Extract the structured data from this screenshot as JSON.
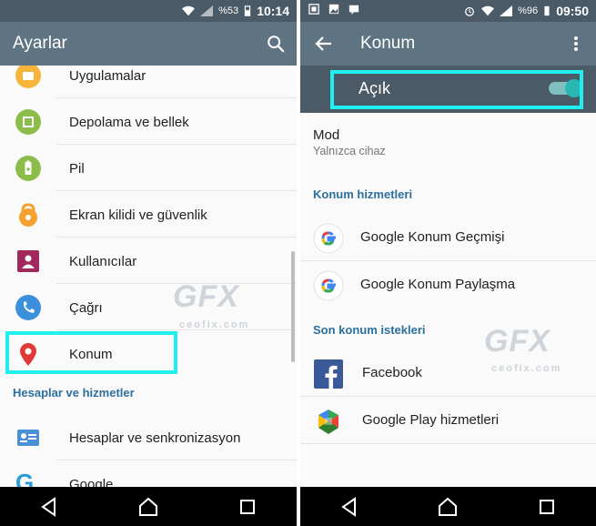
{
  "left": {
    "status": {
      "battery_pct": "%53",
      "time": "10:14"
    },
    "appbar": {
      "title": "Ayarlar",
      "search_icon": "search-icon"
    },
    "items": [
      {
        "label": "Uygulamalar",
        "icon": "apps-icon"
      },
      {
        "label": "Depolama ve bellek",
        "icon": "storage-icon"
      },
      {
        "label": "Pil",
        "icon": "battery-icon"
      },
      {
        "label": "Ekran kilidi ve güvenlik",
        "icon": "lock-icon"
      },
      {
        "label": "Kullanıcılar",
        "icon": "users-icon"
      },
      {
        "label": "Çağrı",
        "icon": "phone-icon"
      },
      {
        "label": "Konum",
        "icon": "location-pin-icon"
      }
    ],
    "section_accounts": "Hesaplar ve hizmetler",
    "accounts_items": [
      {
        "label": "Hesaplar ve senkronizasyon",
        "icon": "account-card-icon"
      },
      {
        "label": "Google",
        "icon": "google-icon"
      }
    ]
  },
  "right": {
    "status": {
      "battery_pct": "%96",
      "time": "09:50"
    },
    "appbar": {
      "title": "Konum"
    },
    "toggle": {
      "label": "Açık",
      "on": true
    },
    "mode": {
      "title": "Mod",
      "subtitle": "Yalnızca cihaz"
    },
    "section_services": "Konum hizmetleri",
    "services": [
      {
        "label": "Google Konum Geçmişi",
        "icon": "google-icon"
      },
      {
        "label": "Google Konum Paylaşma",
        "icon": "google-icon"
      }
    ],
    "section_recent": "Son konum istekleri",
    "recent": [
      {
        "label": "Facebook",
        "icon": "facebook-icon"
      },
      {
        "label": "Google Play hizmetleri",
        "icon": "google-play-services-icon"
      }
    ]
  },
  "watermark": {
    "logo": "GFX",
    "site": "ceofix.com"
  },
  "colors": {
    "appbar": "#5f7482",
    "statusbar": "#4a5a66",
    "accent": "#2ab6b4",
    "highlight": "#1ef0f0",
    "section": "#2b6f9e"
  }
}
